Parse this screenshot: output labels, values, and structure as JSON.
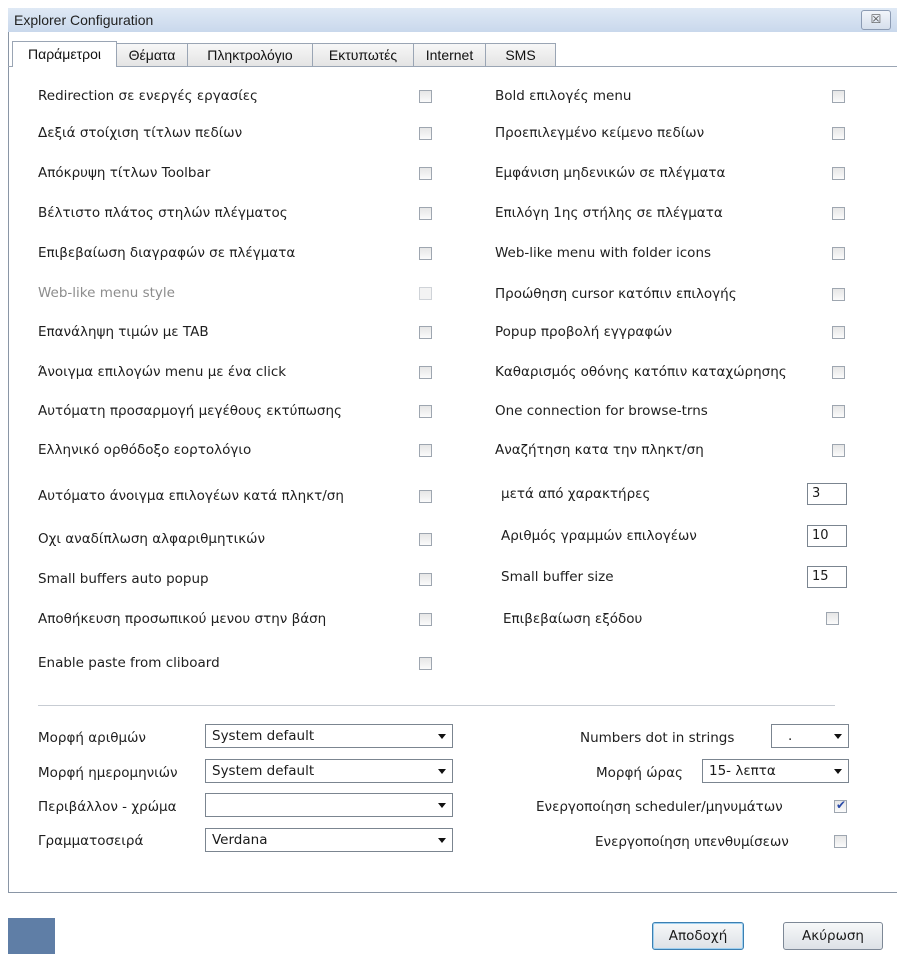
{
  "window": {
    "title": "Explorer Configuration",
    "close_glyph": "☒"
  },
  "tabs": [
    "Παράμετροι",
    "Θέματα",
    "Πληκτρολόγιο",
    "Εκτυπωτές",
    "Internet",
    "SMS"
  ],
  "left_options": [
    {
      "label": "Redirection σε ενεργές εργασίες",
      "checked": false,
      "disabled": false
    },
    {
      "label": "Δεξιά στοίχιση τίτλων πεδίων",
      "checked": false,
      "disabled": false
    },
    {
      "label": "Απόκρυψη τίτλων Toolbar",
      "checked": false,
      "disabled": false
    },
    {
      "label": "Βέλτιστο πλάτος στηλών πλέγματος",
      "checked": false,
      "disabled": false
    },
    {
      "label": "Επιβεβαίωση διαγραφών σε πλέγματα",
      "checked": false,
      "disabled": false
    },
    {
      "label": "Web-like menu style",
      "checked": false,
      "disabled": true
    },
    {
      "label": "Επανάληψη τιμών με TAB",
      "checked": false,
      "disabled": false
    },
    {
      "label": "Άνοιγμα επιλογών menu με ένα click",
      "checked": false,
      "disabled": false
    },
    {
      "label": "Αυτόματη προσαρμογή μεγέθους εκτύπωσης",
      "checked": false,
      "disabled": false
    },
    {
      "label": "Ελληνικό ορθόδοξο εορτολόγιο",
      "checked": false,
      "disabled": false
    },
    {
      "label": "Αυτόματο άνοιγμα επιλογέων κατά πληκτ/ση",
      "checked": false,
      "disabled": false
    },
    {
      "label": "Οχι αναδίπλωση αλφαριθμητικών",
      "checked": false,
      "disabled": false
    },
    {
      "label": "Small buffers auto popup",
      "checked": false,
      "disabled": false
    },
    {
      "label": "Αποθήκευση προσωπικού μενου στην βάση",
      "checked": false,
      "disabled": false
    },
    {
      "label": "Enable paste from cliboard",
      "checked": false,
      "disabled": false
    }
  ],
  "right_options": [
    {
      "label": "Bold επιλογές menu",
      "checked": false
    },
    {
      "label": "Προεπιλεγμένο κείμενο πεδίων",
      "checked": false
    },
    {
      "label": "Εμφάνιση μηδενικών σε πλέγματα",
      "checked": false
    },
    {
      "label": "Επιλόγη 1ης στήλης σε πλέγματα",
      "checked": false
    },
    {
      "label": "Web-like menu with folder icons",
      "checked": false
    },
    {
      "label": "Προώθηση cursor κατόπιν επιλογής",
      "checked": false
    },
    {
      "label": "Popup προβολή εγγραφών",
      "checked": false
    },
    {
      "label": "Καθαρισμός οθόνης κατόπιν καταχώρησης",
      "checked": false
    },
    {
      "label": "One connection for browse-trns",
      "checked": false
    },
    {
      "label": "Αναζήτηση κατα την πληκτ/ση",
      "checked": false
    }
  ],
  "number_fields": [
    {
      "label": "μετά από χαρακτήρες",
      "value": "3"
    },
    {
      "label": "Αριθμός γραμμών επιλογέων",
      "value": "10"
    },
    {
      "label": "Small buffer size",
      "value": "15"
    }
  ],
  "exit_confirm": {
    "label": "Επιβεβαίωση εξόδου",
    "checked": false
  },
  "left_selects": [
    {
      "label": "Μορφή αριθμών",
      "value": "System default"
    },
    {
      "label": "Μορφή ημερομηνιών",
      "value": "System default"
    },
    {
      "label": "Περιβάλλον - χρώμα",
      "value": ""
    },
    {
      "label": "Γραμματοσειρά",
      "value": "Verdana"
    }
  ],
  "right_controls": {
    "numbers_dot": {
      "label": "Numbers dot in strings",
      "value": "."
    },
    "time_format": {
      "label": "Μορφή ώρας",
      "value": "15- λεπτα"
    },
    "scheduler": {
      "label": "Ενεργοποίηση scheduler/μηνυμάτων",
      "checked": true
    },
    "reminders": {
      "label": "Ενεργοποίηση υπενθυμίσεων",
      "checked": false
    }
  },
  "buttons": {
    "accept": "Αποδοχή",
    "cancel": "Ακύρωση"
  }
}
